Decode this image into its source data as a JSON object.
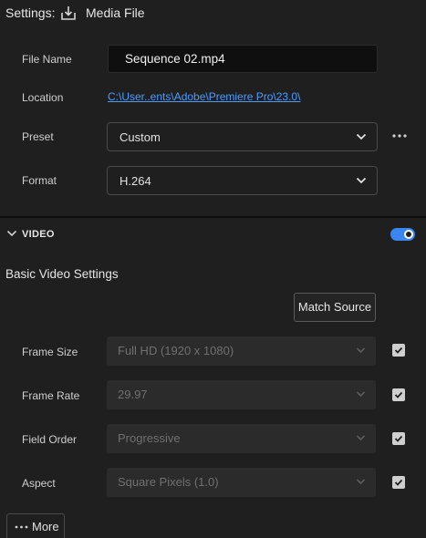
{
  "header": {
    "settings_label": "Settings:",
    "icon": "download-icon",
    "title": "Media File"
  },
  "file_name": {
    "label": "File Name",
    "value": "Sequence 02.mp4"
  },
  "location": {
    "label": "Location",
    "path": "C:\\User..ents\\Adobe\\Premiere Pro\\23.0\\"
  },
  "preset": {
    "label": "Preset",
    "value": "Custom",
    "more_icon": "more-options-icon"
  },
  "format": {
    "label": "Format",
    "value": "H.264"
  },
  "video_section": {
    "title": "VIDEO",
    "expanded": true,
    "enabled": true
  },
  "basic_video": {
    "title": "Basic Video Settings",
    "match_source_label": "Match Source",
    "rows": [
      {
        "label": "Frame Size",
        "value": "Full HD (1920 x 1080)",
        "checked": true
      },
      {
        "label": "Frame Rate",
        "value": "29.97",
        "checked": true
      },
      {
        "label": "Field Order",
        "value": "Progressive",
        "checked": true
      },
      {
        "label": "Aspect",
        "value": "Square Pixels (1.0)",
        "checked": true
      }
    ]
  },
  "more_button": {
    "label": "More"
  },
  "colors": {
    "accent": "#3a85ee",
    "link": "#4a9cff",
    "background": "#1f1f1f"
  }
}
